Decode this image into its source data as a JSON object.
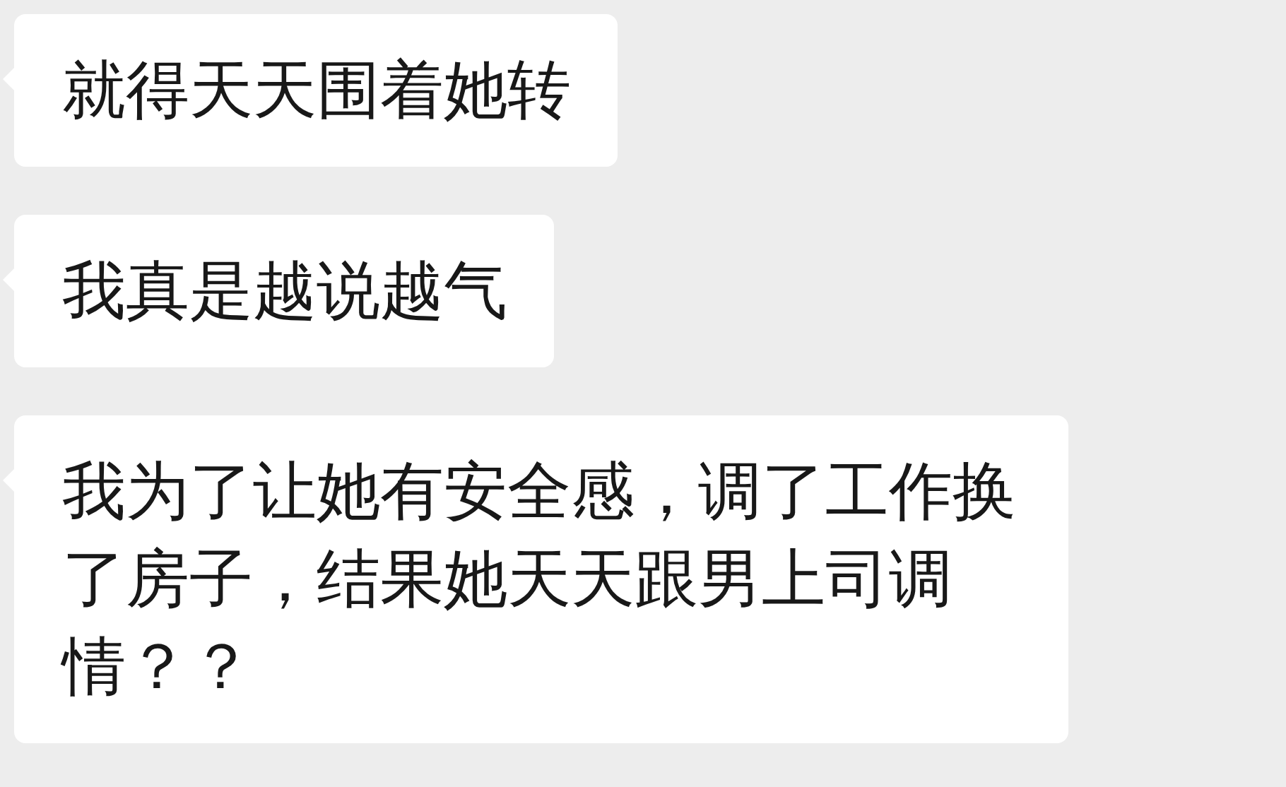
{
  "messages": [
    {
      "text": "就得天天围着她转"
    },
    {
      "text": "我真是越说越气"
    },
    {
      "text": "我为了让她有安全感，调了工作换了房子，结果她天天跟男上司调情？？"
    }
  ]
}
